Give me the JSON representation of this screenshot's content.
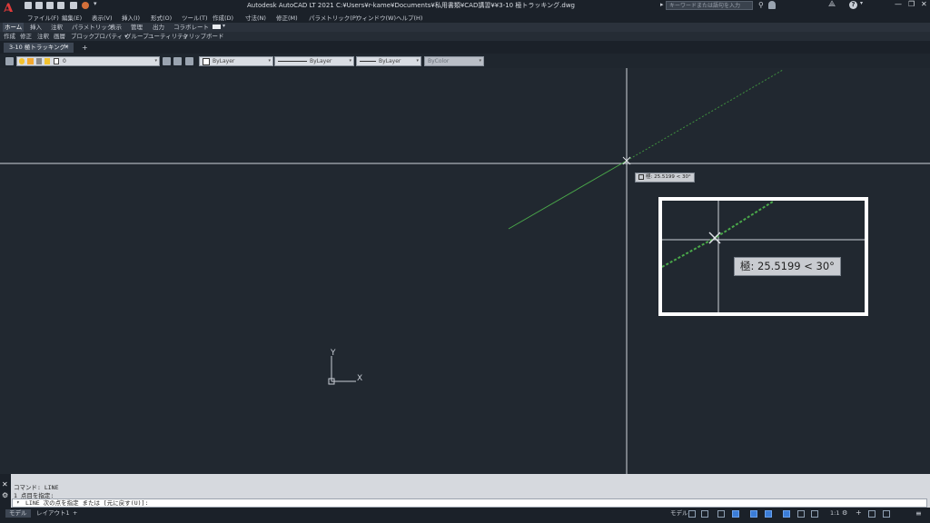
{
  "app": {
    "logo_letter": "A",
    "title": "Autodesk AutoCAD LT 2021    C:¥Users¥r-kame¥Documents¥私用書類¥CAD講習¥¥3-10 極トラッキング.dwg",
    "search_placeholder": "キーワードまたは語句を入力"
  },
  "menubar": {
    "items": [
      "ファイル(F)",
      "編集(E)",
      "表示(V)",
      "挿入(I)",
      "形式(O)",
      "ツール(T)",
      "作成(D)",
      "寸法(N)",
      "修正(M)",
      "パラメトリック(P)",
      "ウィンドウ(W)",
      "ヘルプ(H)"
    ]
  },
  "ribbon": {
    "tabs": [
      "ホーム",
      "挿入",
      "注釈",
      "パラメトリック",
      "表示",
      "管理",
      "出力",
      "コラボレート"
    ],
    "active_tab": "ホーム",
    "panels": [
      "作成",
      "修正",
      "注釈",
      "画層",
      "ブロック",
      "プロパティ ▾",
      "グループ",
      "ユーティリティ",
      "クリップボード"
    ]
  },
  "file_tab": {
    "label": "3-10 極トラッキング*",
    "close": "✕",
    "new_tab": "+"
  },
  "layer_toolbar": {
    "current_layer": "0",
    "color_dropdown": "ByLayer",
    "linetype_dropdown": "ByLayer",
    "lineweight_dropdown": "ByLayer",
    "plotstyle_dropdown": "ByColor"
  },
  "canvas": {
    "tooltip": "極: 25.5199 < 30°",
    "zoom_tooltip": "極: 25.5199 < 30°",
    "ucs_x_label": "X",
    "ucs_y_label": "Y",
    "colors": {
      "background": "#212830",
      "crosshair": "#d0d4da",
      "tracking_line": "#4aa84a"
    }
  },
  "command": {
    "history": [
      "コマンド: LINE",
      "1 点目を指定:"
    ],
    "prompt": "LINE 次の点を指定 または [元に戻す(U)]:"
  },
  "status": {
    "tabs": [
      "モデル",
      "レイアウト1"
    ],
    "add_tab": "+",
    "model_label": "モデル",
    "scale": "1:1"
  }
}
